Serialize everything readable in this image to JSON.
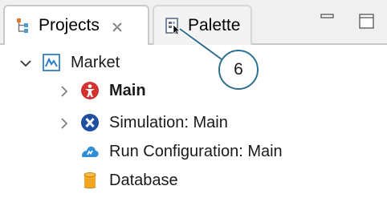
{
  "tabs": {
    "projects": {
      "label": "Projects",
      "icon": "projects-icon"
    },
    "palette": {
      "label": "Palette",
      "icon": "palette-icon"
    }
  },
  "window_controls": [
    "minimize-icon",
    "maximize-icon"
  ],
  "tree": {
    "root": {
      "label": "Market",
      "icon": "model-icon",
      "expanded": true
    },
    "children": [
      {
        "label": "Main",
        "icon": "agent-icon",
        "bold": true,
        "expandable": true
      },
      {
        "label": "Simulation: Main",
        "icon": "simulation-icon",
        "bold": false,
        "expandable": true
      },
      {
        "label": "Run Configuration: Main",
        "icon": "run-configuration-icon",
        "bold": false,
        "expandable": false
      },
      {
        "label": "Database",
        "icon": "database-icon",
        "bold": false,
        "expandable": false
      }
    ]
  },
  "callout": {
    "number": "6"
  },
  "colors": {
    "accent": "#2f6f8f",
    "agent_red": "#d33030",
    "simulation_blue": "#1f4fa0",
    "run_config_blue": "#2f8fd6",
    "database_orange": "#f5a623"
  }
}
